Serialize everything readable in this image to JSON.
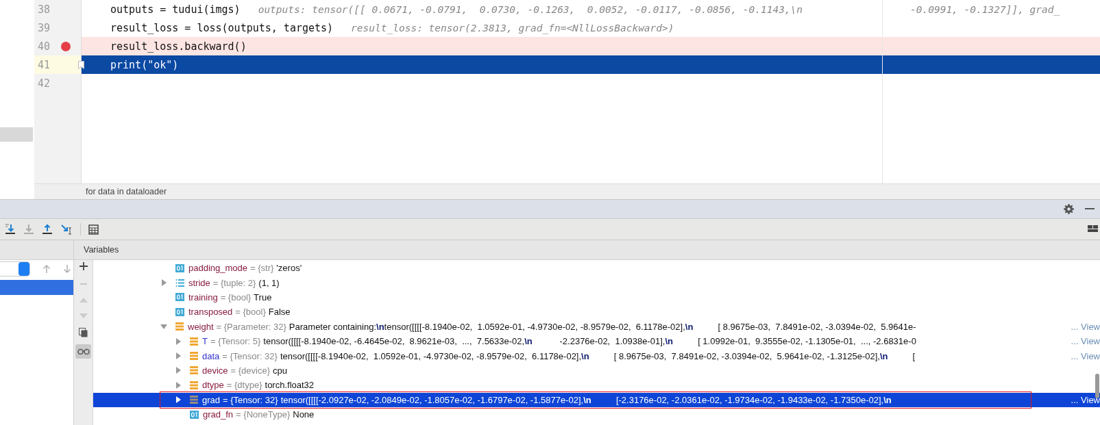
{
  "editor": {
    "lines": [
      {
        "number": "38",
        "code": "outputs = tudui(imgs)",
        "hint": "outputs: tensor([[ 0.0671, -0.0791,  0.0730, -0.1263,  0.0052, -0.0117, -0.0856, -0.1143,\\n",
        "side": "-0.0991, -0.1327]], grad_",
        "breakpoint": false,
        "current": false
      },
      {
        "number": "39",
        "code": "result_loss = loss(outputs, targets)",
        "hint": "result_loss: tensor(2.3813, grad_fn=<NllLossBackward>)",
        "breakpoint": false,
        "current": false
      },
      {
        "number": "40",
        "code": "result_loss.backward()",
        "breakpoint": true,
        "current": false
      },
      {
        "number": "41",
        "code": "print(\"ok\")",
        "breakpoint": false,
        "current": true
      },
      {
        "number": "42",
        "breakpoint": false,
        "current": false
      }
    ],
    "breadcrumb": "for data in dataloader"
  },
  "debugger": {
    "frames": [
      {
        "selected": true
      }
    ],
    "variables_title": "Variables",
    "view_toggle": {
      "on": true
    },
    "variables": [
      {
        "kind": "scalar",
        "name": "padding_mode",
        "type": "= {str}",
        "value": "'zeros'",
        "selected": false,
        "outlined": false
      },
      {
        "kind": "tuple",
        "name": "stride",
        "type": "= {tuple: 2}",
        "value": "(1, 1)",
        "expanded": false,
        "selected": false,
        "outlined": false
      },
      {
        "kind": "scalar",
        "name": "training",
        "type": "= {bool}",
        "value": "True",
        "selected": false,
        "outlined": false
      },
      {
        "kind": "scalar",
        "name": "transposed",
        "type": "= {bool}",
        "value": "False",
        "selected": false,
        "outlined": false
      },
      {
        "kind": "object",
        "name": "weight",
        "type": "= {Parameter: 32}",
        "value": "Parameter containing:**\\n**tensor([[[[-8.1940e-02,  1.0592e-01, -4.9730e-02, -8.9579e-02,  6.1178e-02],**\\n**          [ 8.9675e-03,  7.8491e-02, -3.0394e-02,  5.9641e-",
        "view": "... View",
        "expanded": true,
        "selected": false,
        "outlined": false,
        "children": [
          {
            "kind": "object",
            "name": "T",
            "property": true,
            "type": "= {Tensor: 5}",
            "value": "tensor([[[[-8.1940e-02, -6.4645e-02,  8.9621e-03,  ...,  7.5633e-02,**\\n**           -2.2376e-02,  1.0938e-01],**\\n**          [ 1.0992e-01,  9.3555e-02, -1.1305e-01,  ..., -2.6831e-0",
            "view": "... View",
            "expanded": false,
            "selected": false,
            "outlined": false
          },
          {
            "kind": "object",
            "name": "data",
            "property": true,
            "type": "= {Tensor: 32}",
            "value": "tensor([[[[-8.1940e-02,  1.0592e-01, -4.9730e-02, -8.9579e-02,  6.1178e-02],**\\n**          [ 8.9675e-03,  7.8491e-02, -3.0394e-02,  5.9641e-02, -1.3125e-02],**\\n**          [",
            "view": "... View",
            "expanded": false,
            "selected": false,
            "outlined": false
          },
          {
            "kind": "object",
            "name": "device",
            "property": false,
            "type": "= {device}",
            "value": "cpu",
            "expanded": false,
            "selected": false,
            "outlined": false
          },
          {
            "kind": "object",
            "name": "dtype",
            "property": false,
            "type": "= {dtype}",
            "value": "torch.float32",
            "expanded": false,
            "selected": false,
            "outlined": false
          },
          {
            "kind": "object",
            "name": "grad",
            "property": false,
            "type": "= {Tensor: 32}",
            "value": "tensor([[[[-2.0927e-02, -2.0849e-02, -1.8057e-02, -1.6797e-02, -1.5877e-02],**\\n**          [-2.3176e-02, -2.0361e-02, -1.9734e-02, -1.9433e-02, -1.7350e-02],**\\n**",
            "view": "... View",
            "expanded": false,
            "selected": true,
            "outlined": true
          },
          {
            "kind": "scalar",
            "name": "grad_fn",
            "property": false,
            "type": "= {NoneType}",
            "value": "None",
            "selected": false,
            "outlined": false
          }
        ]
      }
    ]
  }
}
